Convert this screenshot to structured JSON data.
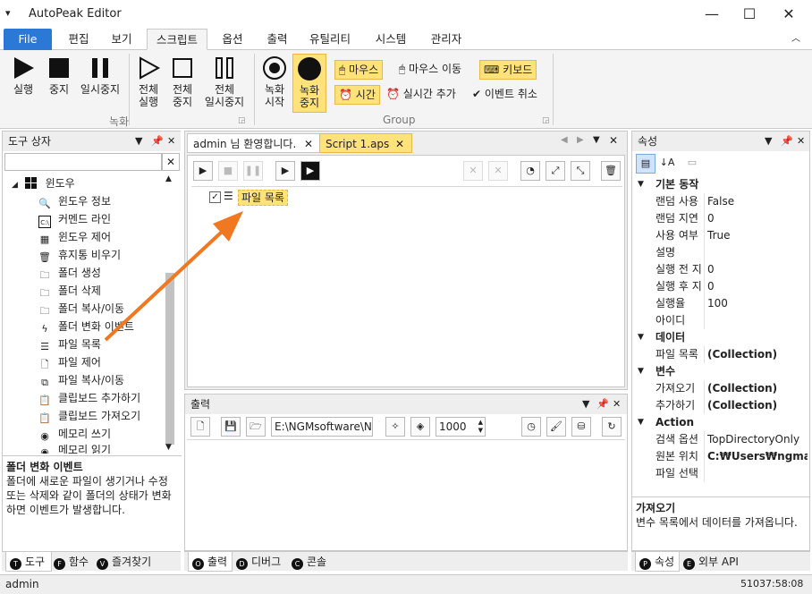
{
  "window": {
    "title": "AutoPeak Editor"
  },
  "ribbon_tabs": [
    "File",
    "편집",
    "보기",
    "스크립트",
    "옵션",
    "출력",
    "유틸리티",
    "시스템",
    "관리자"
  ],
  "ribbon": {
    "run": "실행",
    "stop": "중지",
    "pause": "일시중지",
    "run_all_1": "전체",
    "run_all_2": "실행",
    "stop_all_1": "전체",
    "stop_all_2": "중지",
    "pause_all_1": "전체",
    "pause_all_2": "일시중지",
    "rec_start_1": "녹화",
    "rec_start_2": "시작",
    "rec_stop_1": "녹화",
    "rec_stop_2": "중지",
    "mouse": "마우스",
    "mouse_move": "마우스 이동",
    "keyboard": "키보드",
    "time": "시간",
    "realtime_add": "실시간 추가",
    "event_cancel": "이벤트 취소",
    "group_record": "녹화",
    "group_group": "Group"
  },
  "toolbox": {
    "title": "도구 상자",
    "category": "윈도우",
    "items": [
      "윈도우 정보",
      "커멘드 라인",
      "윈도우 제어",
      "휴지통 비우기",
      "폴더 생성",
      "폴더 삭제",
      "폴더 복사/이동",
      "폴더 변화 이벤트",
      "파일 목록",
      "파일 제어",
      "파일 복사/이동",
      "클립보드 추가하기",
      "클립보드 가져오기",
      "메모리 쓰기",
      "메모리 읽기"
    ],
    "desc_title": "폴더 변화 이벤트",
    "desc_text": "폴더에 새로운 파일이 생기거나 수정 또는 삭제와 같이 폴더의 상태가 변화하면 이벤트가 발생합니다."
  },
  "left_tabs": {
    "t1": "도구",
    "t2": "함수",
    "t3": "즐겨찾기"
  },
  "doc_tabs": {
    "welcome": "admin 님 환영합니다.",
    "script": "Script 1.aps"
  },
  "script": {
    "node": "파일 목록"
  },
  "output": {
    "title": "출력",
    "path": "E:\\NGMsoftware\\NG",
    "count": "1000",
    "tabs": {
      "t1": "출력",
      "t2": "디버그",
      "t3": "콘솔"
    }
  },
  "properties": {
    "title": "속성",
    "sections": [
      {
        "name": "기본 동작",
        "rows": [
          [
            "랜덤 사용",
            "False"
          ],
          [
            "랜덤 지연",
            "0"
          ],
          [
            "사용 여부",
            "True"
          ],
          [
            "설명",
            ""
          ],
          [
            "실행 전 지",
            "0"
          ],
          [
            "실행 후 지",
            "0"
          ],
          [
            "실행율",
            "100"
          ],
          [
            "아이디",
            ""
          ]
        ]
      },
      {
        "name": "데이터",
        "rows": [
          [
            "파일 목록",
            "(Collection)"
          ]
        ]
      },
      {
        "name": "변수",
        "rows": [
          [
            "가져오기",
            "(Collection)"
          ],
          [
            "추가하기",
            "(Collection)"
          ]
        ]
      },
      {
        "name": "Action",
        "rows": [
          [
            "검색 옵션",
            "TopDirectoryOnly"
          ],
          [
            "원본 위치",
            "C:₩Users₩ngmaste"
          ],
          [
            "파일 선택",
            ""
          ]
        ]
      }
    ],
    "desc_title": "가져오기",
    "desc_text": "변수 목록에서 데이터를 가져옵니다.",
    "tabs": {
      "t1": "속성",
      "t2": "외부 API"
    }
  },
  "status": {
    "user": "admin",
    "time": "51037:58:08"
  },
  "colors": {
    "accent": "#2b78d6",
    "highlight": "#ffe27a",
    "arrow": "#f07820"
  }
}
